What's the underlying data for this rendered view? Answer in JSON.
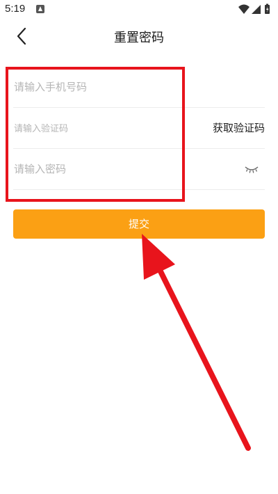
{
  "status_bar": {
    "time": "5:19"
  },
  "header": {
    "title": "重置密码",
    "back_icon": "chevron-left-icon"
  },
  "form": {
    "phone_placeholder": "请输入手机号码",
    "code_placeholder": "请输入验证码",
    "get_code_label": "获取验证码",
    "password_placeholder": "请输入密码",
    "password_toggle_icon": "eye-closed-icon"
  },
  "submit": {
    "label": "提交"
  },
  "colors": {
    "accent": "#fba014",
    "annotation": "#e8141c"
  }
}
